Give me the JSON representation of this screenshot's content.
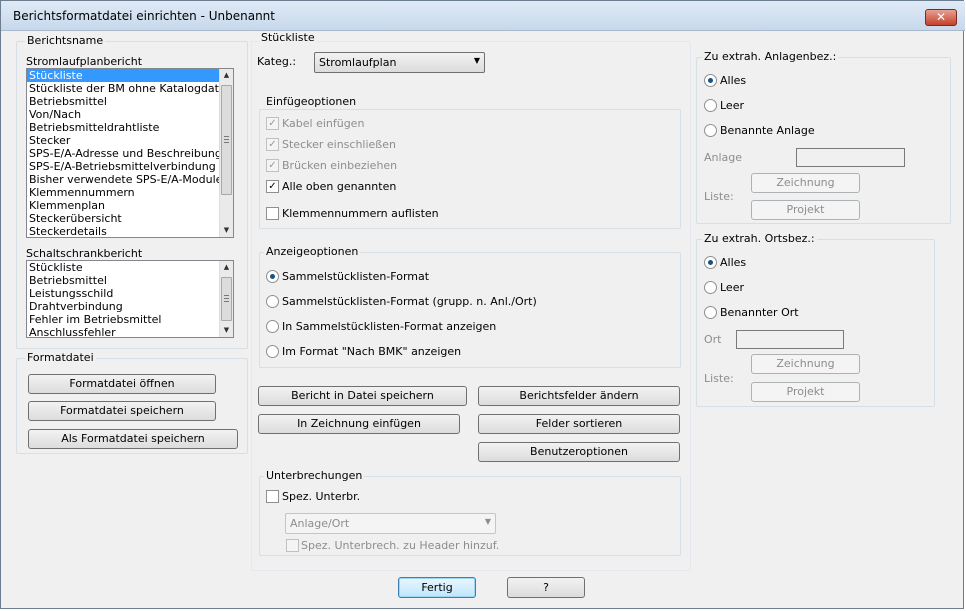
{
  "window": {
    "title": "Berichtsformatdatei einrichten - Unbenannt",
    "close_glyph": "✕"
  },
  "berichtsname": {
    "label": "Berichtsname",
    "strom_label": "Stromlaufplanbericht",
    "strom_items": [
      "Stückliste",
      "Stückliste der BM ohne Katalogdaten",
      "Betriebsmittel",
      "Von/Nach",
      "Betriebsmitteldrahtliste",
      "Stecker",
      "SPS-E/A-Adresse und Beschreibungen",
      "SPS-E/A-Betriebsmittelverbindung",
      "Bisher verwendete SPS-E/A-Module",
      "Klemmennummern",
      "Klemmenplan",
      "Steckerübersicht",
      "Steckerdetails"
    ],
    "schalt_label": "Schaltschrankbericht",
    "schalt_items": [
      "Stückliste",
      "Betriebsmittel",
      "Leistungsschild",
      "Drahtverbindung",
      "Fehler im Betriebsmittel",
      "Anschlussfehler"
    ]
  },
  "formatdatei": {
    "label": "Formatdatei",
    "open": "Formatdatei öffnen",
    "save": "Formatdatei speichern",
    "save_as": "Als Formatdatei speichern"
  },
  "stueckliste": {
    "label": "Stückliste",
    "kateg_label": "Kateg.:",
    "kateg_value": "Stromlaufplan"
  },
  "einfuege": {
    "label": "Einfügeoptionen",
    "kabel": "Kabel einfügen",
    "stecker": "Stecker einschließen",
    "bruecken": "Brücken einbeziehen",
    "alle": "Alle oben genannten",
    "klemmen": "Klemmennummern auflisten"
  },
  "anzeige": {
    "label": "Anzeigeoptionen",
    "opt1": "Sammelstücklisten-Format",
    "opt2": "Sammelstücklisten-Format (grupp. n. Anl./Ort)",
    "opt3": "In Sammelstücklisten-Format anzeigen",
    "opt4": "Im Format \"Nach BMK\" anzeigen"
  },
  "actions": {
    "bericht_speichern": "Bericht in Datei speichern",
    "zeichnung_einfuegen": "In Zeichnung einfügen",
    "berichtsfelder": "Berichtsfelder ändern",
    "felder_sortieren": "Felder sortieren",
    "benutzeroptionen": "Benutzeroptionen"
  },
  "unterbrechungen": {
    "label": "Unterbrechungen",
    "spez": "Spez. Unterbr.",
    "combo": "Anlage/Ort",
    "header": "Spez. Unterbrech. zu Header hinzuf."
  },
  "anlage": {
    "label": "Zu extrah. Anlagenbez.:",
    "alles": "Alles",
    "leer": "Leer",
    "benannt": "Benannte Anlage",
    "field_label": "Anlage",
    "liste": "Liste:",
    "zeichnung": "Zeichnung",
    "projekt": "Projekt"
  },
  "ort": {
    "label": "Zu extrah. Ortsbez.:",
    "alles": "Alles",
    "leer": "Leer",
    "benannt": "Benannter Ort",
    "field_label": "Ort",
    "liste": "Liste:",
    "zeichnung": "Zeichnung",
    "projekt": "Projekt"
  },
  "footer": {
    "fertig": "Fertig",
    "help": "?"
  },
  "icons": {
    "checkmark": "✓",
    "dropdown": "▼",
    "scroll_up": "▲",
    "scroll_down": "▼"
  }
}
